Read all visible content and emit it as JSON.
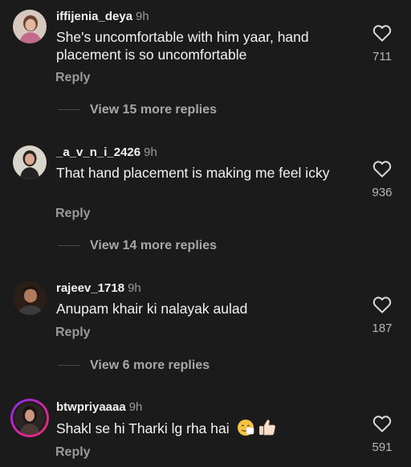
{
  "comments": [
    {
      "username": "iffijenia_deya",
      "time": "9h",
      "text": "She's uncomfortable with him yaar, hand placement is so uncomfortable",
      "reply_label": "Reply",
      "likes": "711",
      "view_more": "View 15 more replies"
    },
    {
      "username": "_a_v_n_i_2426",
      "time": "9h",
      "text": "That hand placement is making me feel icky",
      "reply_label": "Reply",
      "likes": "936",
      "view_more": "View 14 more replies"
    },
    {
      "username": "rajeev_1718",
      "time": "9h",
      "text": "Anupam khair ki nalayak aulad",
      "reply_label": "Reply",
      "likes": "187",
      "view_more": "View 6 more replies"
    },
    {
      "username": "btwpriyaaaa",
      "time": "9h",
      "text": "Shakl se hi Tharki lg rha hai",
      "emojis": [
        "sneezing-face-emoji",
        "thumbs-up-emoji"
      ],
      "reply_label": "Reply",
      "likes": "591"
    }
  ],
  "icons": {
    "like": "heart-outline-icon"
  },
  "colors": {
    "background": "#1b1b1b",
    "text": "#f2f2f2",
    "secondary": "#9a9a9a",
    "story_ring_start": "#7b2ff7",
    "story_ring_end": "#e1306c"
  }
}
